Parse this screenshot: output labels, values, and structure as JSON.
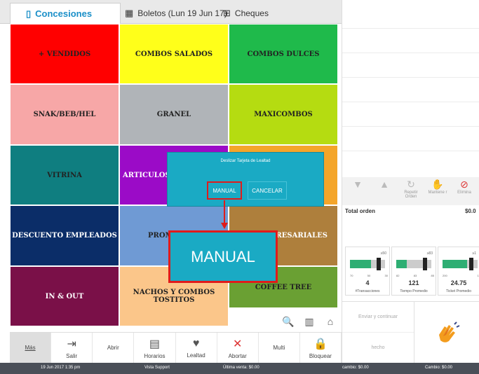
{
  "tabs": [
    {
      "label": "Concesiones",
      "icon": "phone-icon"
    },
    {
      "label": "Boletos (Lun 19 Jun 17)",
      "icon": "cinema-icon"
    },
    {
      "label": "Cheques",
      "icon": "cheques-icon"
    }
  ],
  "tiles": [
    {
      "label": "+ VENDIDOS",
      "color": "#ff0000"
    },
    {
      "label": "COMBOS SALADOS",
      "color": "#ffff1a"
    },
    {
      "label": "COMBOS DULCES",
      "color": "#1fba4b"
    },
    {
      "label": "SNAK/BEB/HEL",
      "color": "#f7a7a7"
    },
    {
      "label": "GRANEL",
      "color": "#b0b4b8"
    },
    {
      "label": "MAXICOMBOS",
      "color": "#b5dc11"
    },
    {
      "label": "VITRINA",
      "color": "#0f7e80"
    },
    {
      "label": "ARTICULOS P",
      "color": "#9b0bc7"
    },
    {
      "label": "",
      "color": "#f4a52a"
    },
    {
      "label": "DESCUENTO EMPLEADOS",
      "color": "#0b2d68"
    },
    {
      "label": "PROMO",
      "color": "#6f9ad4"
    },
    {
      "label": "MPRESARIALES",
      "color": "#ae7f3c"
    },
    {
      "label": "IN & OUT",
      "color": "#7a1048"
    },
    {
      "label": "NACHOS Y COMBOS TOSTITOS",
      "color": "#fbc68a"
    },
    {
      "label": "COFFEE TREE",
      "color": "#6aa033"
    }
  ],
  "popup": {
    "title": "Deslizar Tarjeta de Lealtad",
    "manual_label": "MANUAL",
    "cancel_label": "CANCELAR",
    "zoom_label": "MANUAL"
  },
  "tools": {
    "search": "🔍",
    "barcode": "▥",
    "home": "⌂"
  },
  "toolbar": [
    {
      "label": "Más",
      "icon": ""
    },
    {
      "label": "Salir",
      "icon": "⇥"
    },
    {
      "label": "Abrir",
      "icon": ""
    },
    {
      "label": "Horarios",
      "icon": "▤"
    },
    {
      "label": "Lealtad",
      "icon": "♥"
    },
    {
      "label": "Abortar",
      "icon": "✕"
    },
    {
      "label": "Multi",
      "icon": ""
    },
    {
      "label": "Bloquear",
      "icon": "🔒"
    }
  ],
  "status": {
    "date": "19 Jun 2017 1:35 pm",
    "support": "Vista Support",
    "last_sale": "Última venta: $0.00",
    "cambio1": "cambio: $0.00",
    "cambio2": "Cambio: $0.00"
  },
  "order": {
    "controls": [
      {
        "label": "",
        "icon": "▼"
      },
      {
        "label": "",
        "icon": "▲"
      },
      {
        "label": "Repetir Orden",
        "icon": "↻"
      },
      {
        "label": "Mantene r",
        "icon": "✋"
      },
      {
        "label": "Elimina",
        "icon": "⊘"
      }
    ],
    "total_label": "Total orden",
    "total_value": "$0.0"
  },
  "metrics": [
    {
      "top": "≥50",
      "scale": [
        "70",
        "50",
        "30"
      ],
      "value": "4",
      "label": "#Transacciones",
      "level": 0.6
    },
    {
      "top": "≥83",
      "scale": [
        "82",
        "83",
        "85"
      ],
      "value": "121",
      "label": "Tiempo Promedio",
      "level": 0.3
    },
    {
      "top": "≥1",
      "scale": [
        "200",
        "12"
      ],
      "value": "24.75",
      "label": "Ticket Promedio",
      "level": 0.7
    }
  ],
  "actions": {
    "send": "Enviar y continuar",
    "done": "hecho",
    "hand_icon": "clap-icon"
  }
}
